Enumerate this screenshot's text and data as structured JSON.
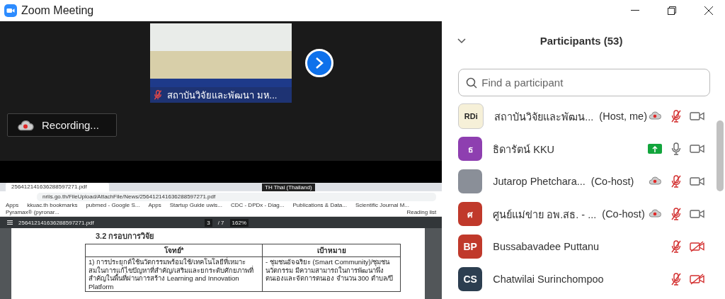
{
  "window": {
    "title": "Zoom Meeting"
  },
  "video": {
    "tile_name": "สถาบันวิจัยและพัฒนา มห...",
    "muted": true
  },
  "recording": {
    "label": "Recording..."
  },
  "shared_screen": {
    "browser": {
      "tab_title": "256412141636288597271.pdf",
      "language_badge": "TH Thai (Thailand)",
      "url": "nriis.go.th/FileUpload/AttachFile/News/256412141636288597271.pdf",
      "bookmarks": [
        "Apps",
        "kkuac.th bookmarks",
        "pubmed - Google S...",
        "Apps",
        "Startup Guide uwis...",
        "CDC - DPDx - Diag...",
        "Publications & Data...",
        "Scientific Journal M...",
        "Pyramax® (pyronar..."
      ],
      "reading_list": "Reading list"
    },
    "pdf": {
      "file_name": "256412141636288597271.pdf",
      "page": "3",
      "pages": "/ 7",
      "zoom": "162%",
      "heading": "3.2 กรอบการวิจัย",
      "columns": [
        "โจทย์*",
        "เป้าหมาย"
      ],
      "rows": [
        [
          "1) การประยุกต์ใช้นวัตกรรมพร้อมใช้/เทคโนโลยีที่เหมาะสมในการแก้ไขปัญหาที่สำคัญ/เสริมและยกระดับศักยภาพที่สำคัญในพื้นที่ผ่านการสร้าง Learning and Innovation Platform",
          "- ชุมชนอัจฉริยะ (Smart Community)/ชุมชนนวัตกรรม มีความสามารถในการพัฒนาพึ่งตนเองและจัดการตนเอง จำนวน 300 ตำบล/ปี"
        ]
      ]
    }
  },
  "participants": {
    "title": "Participants (53)",
    "search": {
      "placeholder": "Find a participant"
    },
    "items": [
      {
        "name": "สถาบันวิจัยและพัฒน...",
        "role": "(Host, me)",
        "avatar": {
          "kind": "logo",
          "text": "RDi"
        },
        "recording": true,
        "sharing": false,
        "muted": true,
        "camera_on": true
      },
      {
        "name": "ธิดารัตน์ KKU",
        "avatar": {
          "kind": "initials",
          "text": "ธ",
          "color": "#8e3fb0"
        },
        "recording": false,
        "sharing": true,
        "muted": false,
        "camera_on": true
      },
      {
        "name": "Jutarop Phetchara...",
        "role": "(Co-host)",
        "avatar": {
          "kind": "photo"
        },
        "recording": true,
        "sharing": false,
        "muted": true,
        "camera_on": true
      },
      {
        "name": "ศูนย์แม่ข่าย อพ.สธ. - ...",
        "role": "(Co-host)",
        "avatar": {
          "kind": "initials",
          "text": "ศ",
          "color": "#c0392b"
        },
        "recording": true,
        "sharing": false,
        "muted": true,
        "camera_on": true
      },
      {
        "name": "Bussabavadee Puttanu",
        "avatar": {
          "kind": "initials",
          "text": "BP",
          "color": "#c0392b"
        },
        "recording": false,
        "sharing": false,
        "muted": true,
        "camera_on": false
      },
      {
        "name": "Chatwilai Surinchompoo",
        "avatar": {
          "kind": "initials",
          "text": "CS",
          "color": "#2c3e50"
        },
        "recording": false,
        "sharing": false,
        "muted": true,
        "camera_on": false
      }
    ]
  }
}
